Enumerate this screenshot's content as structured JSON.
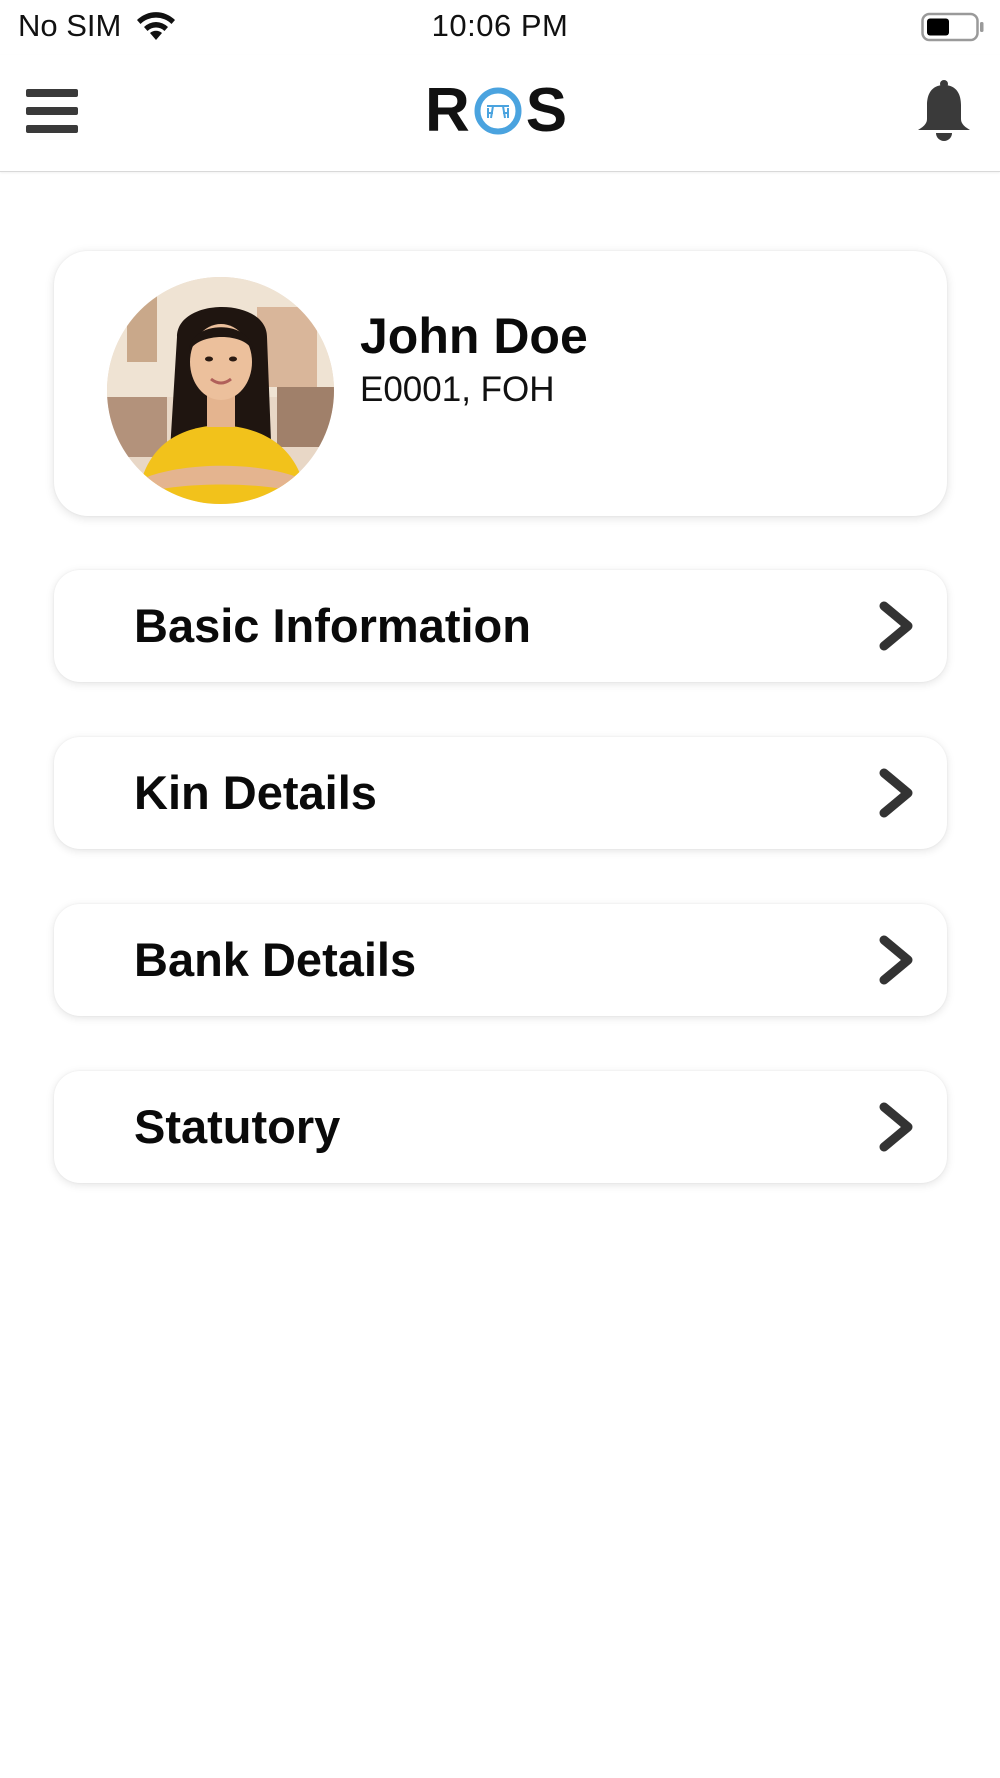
{
  "status_bar": {
    "carrier": "No SIM",
    "time": "10:06 PM",
    "wifi_icon": "wifi-icon",
    "battery_icon": "battery-icon"
  },
  "nav": {
    "menu_icon": "hamburger-menu-icon",
    "logo_text_left": "R",
    "logo_text_right": "S",
    "notification_icon": "bell-icon",
    "brand_color": "#4aa3df"
  },
  "profile": {
    "name": "John Doe",
    "subtitle": "E0001, FOH",
    "avatar": "avatar-photo"
  },
  "menu_items": [
    {
      "label": "Basic Information",
      "icon": "chevron-right-icon"
    },
    {
      "label": "Kin Details",
      "icon": "chevron-right-icon"
    },
    {
      "label": "Bank Details",
      "icon": "chevron-right-icon"
    },
    {
      "label": "Statutory",
      "icon": "chevron-right-icon"
    }
  ]
}
